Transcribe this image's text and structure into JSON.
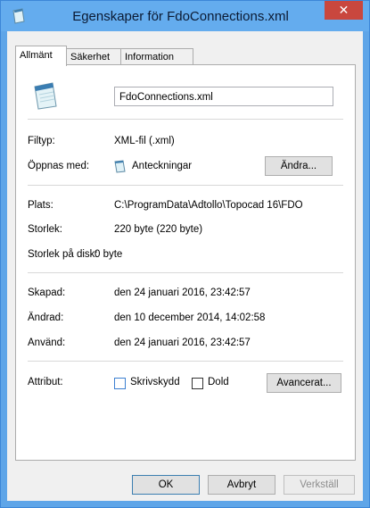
{
  "window": {
    "title": "Egenskaper för FdoConnections.xml",
    "close_glyph": "✕"
  },
  "tabs": [
    "Allmänt",
    "Säkerhet",
    "Information"
  ],
  "general": {
    "filename": "FdoConnections.xml",
    "filetype_label": "Filtyp:",
    "filetype_value": "XML-fil (.xml)",
    "opens_with_label": "Öppnas med:",
    "opens_with_value": "Anteckningar",
    "change_button": "Ändra...",
    "location_label": "Plats:",
    "location_value": "C:\\ProgramData\\Adtollo\\Topocad 16\\FDO",
    "size_label": "Storlek:",
    "size_value": "220 byte (220 byte)",
    "size_on_disk_label": "Storlek på disk:",
    "size_on_disk_value": "0 byte",
    "created_label": "Skapad:",
    "created_value": "den 24 januari 2016, 23:42:57",
    "modified_label": "Ändrad:",
    "modified_value": "den 10 december 2014, 14:02:58",
    "accessed_label": "Använd:",
    "accessed_value": "den 24 januari 2016, 23:42:57",
    "attributes_label": "Attribut:",
    "readonly_label": "Skrivskydd",
    "hidden_label": "Dold",
    "advanced_button": "Avancerat..."
  },
  "footer": {
    "ok": "OK",
    "cancel": "Avbryt",
    "apply": "Verkställ"
  },
  "icons": {
    "app": "notepad-file-icon",
    "file": "notepad-file-icon",
    "opener": "notepad-icon"
  },
  "colors": {
    "titlebar": "#64acee",
    "close": "#c9473e",
    "client": "#f0f0f0"
  }
}
